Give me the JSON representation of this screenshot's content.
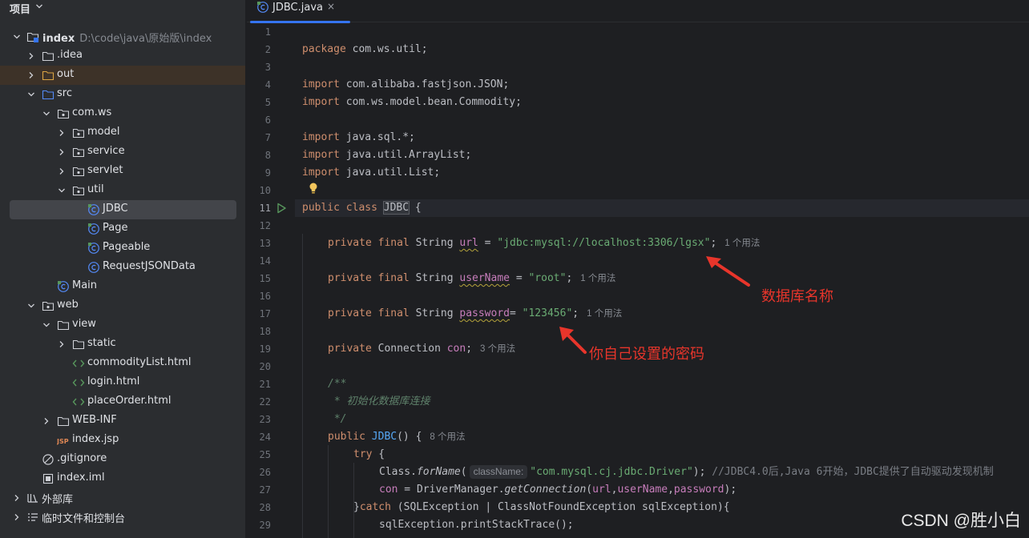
{
  "sidebar": {
    "title": "项目",
    "tree": [
      {
        "label": "index",
        "path": "D:\\code\\java\\原始版\\index",
        "icon": "module-folder-icon",
        "expanded": true
      },
      {
        "label": ".idea",
        "icon": "folder-icon",
        "expanded": false
      },
      {
        "label": "out",
        "icon": "folder-icon",
        "expanded": false
      },
      {
        "label": "src",
        "icon": "source-folder-icon",
        "expanded": true
      },
      {
        "label": "com.ws",
        "icon": "package-icon",
        "expanded": true
      },
      {
        "label": "model",
        "icon": "package-icon",
        "expanded": false
      },
      {
        "label": "service",
        "icon": "package-icon",
        "expanded": false
      },
      {
        "label": "servlet",
        "icon": "package-icon",
        "expanded": false
      },
      {
        "label": "util",
        "icon": "package-icon",
        "expanded": true
      },
      {
        "label": "JDBC",
        "icon": "java-class-icon"
      },
      {
        "label": "Page",
        "icon": "java-class-icon"
      },
      {
        "label": "Pageable",
        "icon": "java-class-icon"
      },
      {
        "label": "RequestJSONData",
        "icon": "java-class-icon"
      },
      {
        "label": "Main",
        "icon": "java-class-icon"
      },
      {
        "label": "web",
        "icon": "web-folder-icon",
        "expanded": true
      },
      {
        "label": "view",
        "icon": "folder-icon",
        "expanded": true
      },
      {
        "label": "static",
        "icon": "folder-icon",
        "expanded": false
      },
      {
        "label": "commodityList.html",
        "icon": "html-file-icon"
      },
      {
        "label": "login.html",
        "icon": "html-file-icon"
      },
      {
        "label": "placeOrder.html",
        "icon": "html-file-icon"
      },
      {
        "label": "WEB-INF",
        "icon": "folder-icon",
        "expanded": false
      },
      {
        "label": "index.jsp",
        "icon": "jsp-file-icon"
      },
      {
        "label": ".gitignore",
        "icon": "gitignore-file-icon"
      },
      {
        "label": "index.iml",
        "icon": "iml-file-icon"
      },
      {
        "label": "外部库",
        "icon": "library-icon",
        "expanded": false
      },
      {
        "label": "临时文件和控制台",
        "icon": "scratches-icon",
        "expanded": false
      }
    ]
  },
  "editor": {
    "tab": {
      "label": "JDBC.java",
      "icon": "java-class-icon",
      "close": "×"
    },
    "current_line": 11,
    "lines": [
      "1",
      "2",
      "3",
      "4",
      "5",
      "6",
      "7",
      "8",
      "9",
      "10",
      "11",
      "12",
      "13",
      "14",
      "15",
      "16",
      "17",
      "18",
      "19",
      "20",
      "21",
      "22",
      "23",
      "24",
      "25",
      "26",
      "27",
      "28",
      "29"
    ],
    "code": {
      "l2_kw": "package",
      "l2_rest": " com.ws.util;",
      "import_kw": "import",
      "l4": " com.alibaba.fastjson.JSON;",
      "l5": " com.ws.model.bean.Commodity;",
      "l7": " java.sql.*;",
      "l8": " java.util.ArrayList;",
      "l9": " java.util.List;",
      "l11_kw": "public class ",
      "l11_name": "JDBC",
      "l11_rest": " {",
      "pf_kw": "private final ",
      "string_type": "String ",
      "l13_field": "url",
      "l13_eq": " = ",
      "l13_str": "\"jdbc:mysql://localhost:3306/lgsx\"",
      "l13_semi": ";",
      "l13_hint": "1 个用法",
      "l15_field": "userName",
      "l15_eq": " = ",
      "l15_str": "\"root\"",
      "l15_semi": ";",
      "l15_hint": "1 个用法",
      "l17_field": "password",
      "l17_eq": "= ",
      "l17_str": "\"123456\"",
      "l17_semi": ";",
      "l17_hint": "1 个用法",
      "l19_kw": "private ",
      "l19_type": "Connection ",
      "l19_field": "con",
      "l19_semi": ";",
      "l19_hint": "3 个用法",
      "l21": "/**",
      "l22": " * 初始化数据库连接",
      "l23": " */",
      "l24_kw": "public ",
      "l24_fn": "JDBC",
      "l24_rest": "() {",
      "l24_hint": "8 个用法",
      "l25_kw": "try",
      "l25_rest": " {",
      "l26_a": "Class.",
      "l26_fn": "forName",
      "l26_b": "(",
      "l26_inlay": "className:",
      "l26_str": "\"com.mysql.cj.jdbc.Driver\"",
      "l26_c": "); ",
      "l26_cmt": "//JDBC4.0后,Java 6开始，JDBC提供了自动驱动发现机制",
      "l27_field": "con",
      "l27_a": " = DriverManager.",
      "l27_fn": "getConnection",
      "l27_b": "(",
      "l27_f1": "url",
      "l27_c": ",",
      "l27_f2": "userName",
      "l27_d": ",",
      "l27_f3": "password",
      "l27_e": ");",
      "l28_a": "}",
      "l28_kw": "catch",
      "l28_rest": " (SQLException | ClassNotFoundException sqlException){",
      "l29_a": "sqlException.",
      "l29_fn": "printStackTrace",
      "l29_b": "();"
    }
  },
  "annotations": {
    "db_name": "数据库名称",
    "password": "你自己设置的密码",
    "color": "#e8352b"
  },
  "watermark": "CSDN @胜小白"
}
